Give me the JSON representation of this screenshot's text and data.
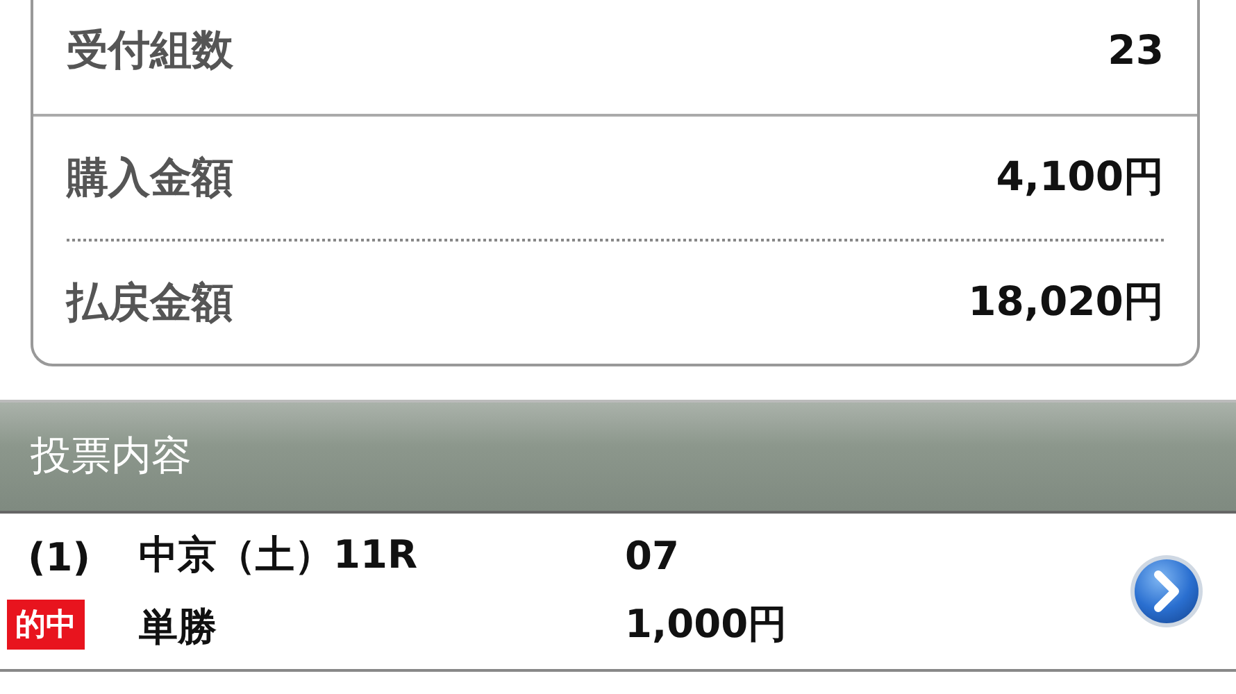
{
  "summary": {
    "rows": [
      {
        "label": "受付組数",
        "value": "23",
        "kind": "solid"
      },
      {
        "label": "購入金額",
        "value": "4,100円",
        "kind": "dotted"
      },
      {
        "label": "払戻金額",
        "value": "18,020円",
        "kind": "plain"
      }
    ]
  },
  "section": {
    "title": "投票内容"
  },
  "bets": [
    {
      "number": "(1)",
      "race": "中京（土）11R",
      "selection": "07",
      "won": true,
      "win_label": "的中",
      "bet_type": "単勝",
      "amount": "1,000円"
    }
  ]
}
